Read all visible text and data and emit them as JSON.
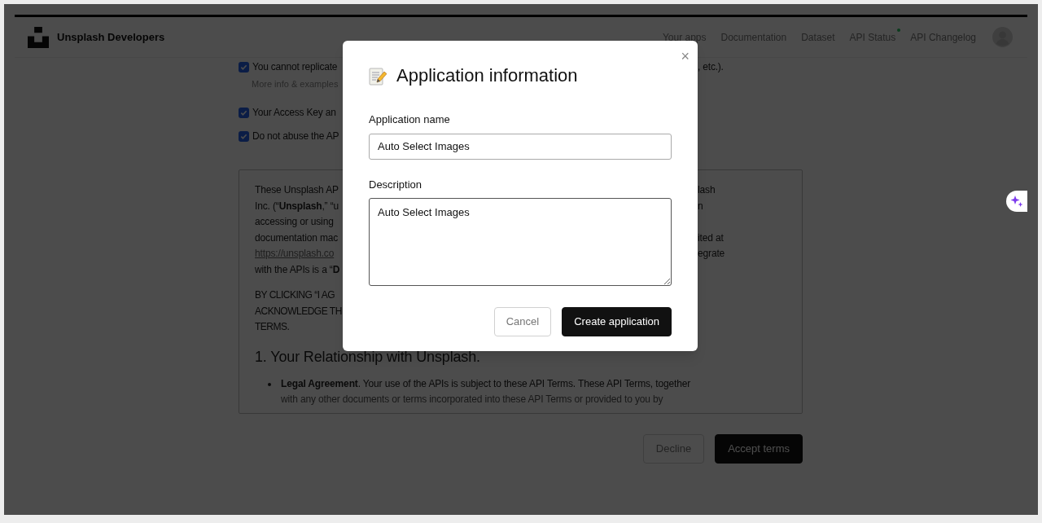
{
  "header": {
    "brand": "Unsplash Developers",
    "nav": [
      {
        "label": "Your apps",
        "status_dot": false
      },
      {
        "label": "Documentation",
        "status_dot": false
      },
      {
        "label": "Dataset",
        "status_dot": false
      },
      {
        "label": "API Status",
        "status_dot": true
      },
      {
        "label": "API Changelog",
        "status_dot": false
      }
    ]
  },
  "checklist": [
    {
      "left": "You cannot replicate",
      "right": ", etc.).",
      "note": "More info & examples",
      "checked": true
    },
    {
      "left": "Your Access Key an",
      "checked": true
    },
    {
      "left": "Do not abuse the AP",
      "checked": true
    }
  ],
  "terms": {
    "intro": [
      {
        "kind": "text",
        "left": "These Unsplash AP",
        "right": "lash"
      },
      {
        "kind": "text",
        "left": "Inc. (“**Unsplash**,” “u",
        "right": "n"
      },
      {
        "kind": "text",
        "left": "accessing or using"
      },
      {
        "kind": "text",
        "left": "documentation mac",
        "right": "ited at"
      },
      {
        "kind": "link",
        "left": "https://unsplash.co",
        "right": "egrate"
      },
      {
        "kind": "text",
        "left": "with the APIs is a “**D**"
      }
    ],
    "notice": [
      "BY CLICKING “I AG",
      "ACKNOWLEDGE TH",
      "TERMS."
    ],
    "heading": "1. Your Relationship with Unsplash.",
    "bullet": "**Legal Agreement**. Your use of the APIs is subject to these API Terms. These API Terms, together",
    "bullet_continued": "with any other documents or terms incorporated into these API Terms or provided to you by"
  },
  "actions": [
    {
      "label": "Decline",
      "kind": "secondary"
    },
    {
      "label": "Accept terms",
      "kind": "primary"
    }
  ],
  "modal": {
    "title": "Application information",
    "close": "×",
    "fields": [
      {
        "kind": "input",
        "label": "Application name",
        "value": "Auto Select Images"
      },
      {
        "kind": "textarea",
        "label": "Description",
        "value": "Auto Select Images"
      }
    ],
    "buttons": [
      {
        "label": "Cancel",
        "kind": "secondary"
      },
      {
        "label": "Create application",
        "kind": "primary"
      }
    ]
  }
}
